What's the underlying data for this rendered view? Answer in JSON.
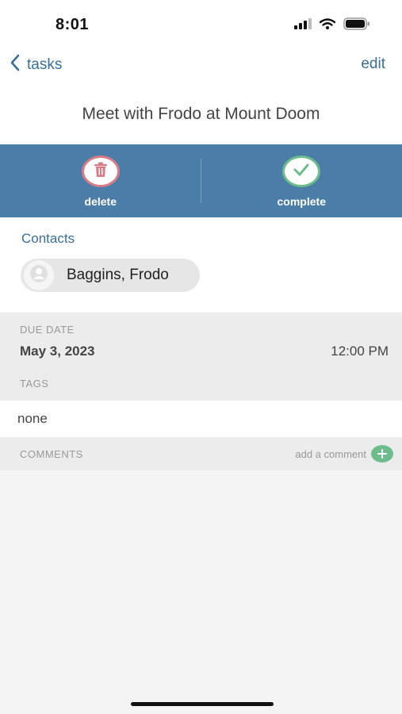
{
  "status_bar": {
    "time": "8:01",
    "icons": [
      "signal-icon",
      "wifi-icon",
      "battery-icon"
    ]
  },
  "nav": {
    "back_label": "tasks",
    "edit_label": "edit"
  },
  "task": {
    "title": "Meet with Frodo at Mount Doom"
  },
  "actions": {
    "delete_label": "delete",
    "complete_label": "complete"
  },
  "contacts": {
    "heading": "Contacts",
    "items": [
      {
        "name": "Baggins, Frodo"
      }
    ]
  },
  "due": {
    "label": "DUE DATE",
    "date": "May 3, 2023",
    "time": "12:00 PM"
  },
  "tags": {
    "label": "TAGS",
    "value": "none"
  },
  "comments": {
    "label": "COMMENTS",
    "add_label": "add a comment"
  },
  "colors": {
    "accent": "#3a6f98",
    "action_bar": "#4a7ea8",
    "delete": "#d77b86",
    "complete": "#6dbc8c"
  }
}
